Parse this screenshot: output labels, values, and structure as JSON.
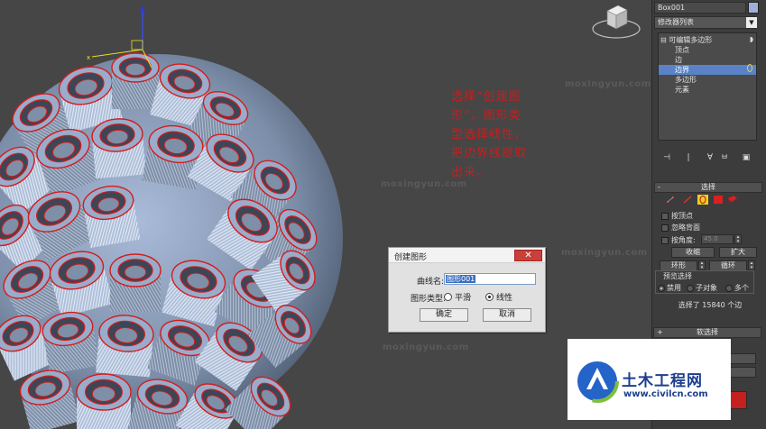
{
  "viewport": {
    "watermarks": [
      "moxingyun.com",
      "moxingyun.com",
      "moxingyun.com",
      "moxingyun.com"
    ],
    "annotation_lines": [
      "选择“创建图",
      "形”，图形类",
      "型选择线性，",
      "把边界线提取",
      "出来。"
    ]
  },
  "dialog": {
    "title": "创建图形",
    "close_label": "✕",
    "name_label": "曲线名:",
    "name_value": "图形001",
    "type_label": "图形类型:",
    "smooth_label": "平滑",
    "linear_label": "线性",
    "selected_type": "linear",
    "ok_label": "确定",
    "cancel_label": "取消"
  },
  "panel": {
    "object_name": "Box001",
    "object_color": "#9fb0d8",
    "modifier_list_label": "修改器列表",
    "stack": {
      "root": "可编辑多边形",
      "items": [
        "顶点",
        "边",
        "边界",
        "多边形",
        "元素"
      ],
      "selected": "边界"
    },
    "selection_rollout": {
      "title": "选择",
      "by_vertex": "按顶点",
      "ignore_backfacing": "忽略背面",
      "by_angle": "按角度:",
      "angle_value": "45.0",
      "shrink": "收缩",
      "grow": "扩大",
      "ring": "环形",
      "loop": "循环",
      "preview_title": "预览选择",
      "preview_options": [
        "禁用",
        "子对象",
        "多个"
      ],
      "preview_selected": "禁用",
      "status": "选择了 15840 个边"
    },
    "soft_selection_title": "软选择"
  },
  "logo": {
    "title": "土木工程网",
    "url": "www.civilcn.com"
  }
}
